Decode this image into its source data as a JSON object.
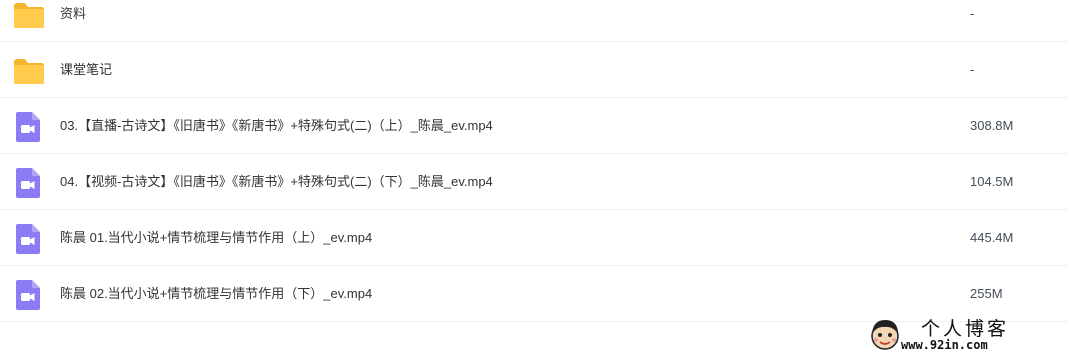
{
  "files": [
    {
      "name": "资料",
      "size": "-",
      "type": "folder",
      "icon": "folder-icon"
    },
    {
      "name": "课堂笔记",
      "size": "-",
      "type": "folder",
      "icon": "folder-icon"
    },
    {
      "name": "03.【直播-古诗文】《旧唐书》《新唐书》+特殊句式(二)（上）_陈晨_ev.mp4",
      "size": "308.8M",
      "type": "video",
      "icon": "video-file-icon"
    },
    {
      "name": "04.【视频-古诗文】《旧唐书》《新唐书》+特殊句式(二)（下）_陈晨_ev.mp4",
      "size": "104.5M",
      "type": "video",
      "icon": "video-file-icon"
    },
    {
      "name": "陈晨 01.当代小说+情节梳理与情节作用（上）_ev.mp4",
      "size": "445.4M",
      "type": "video",
      "icon": "video-file-icon"
    },
    {
      "name": "陈晨 02.当代小说+情节梳理与情节作用（下）_ev.mp4",
      "size": "255M",
      "type": "video",
      "icon": "video-file-icon"
    }
  ],
  "watermark": {
    "title": "个人博客",
    "url": "www.92in.com"
  },
  "colors": {
    "folder": "#ffcc4d",
    "folder_tab": "#f5b52e",
    "video": "#8c7cf3",
    "divider": "#eef0f4",
    "text": "#333333"
  }
}
